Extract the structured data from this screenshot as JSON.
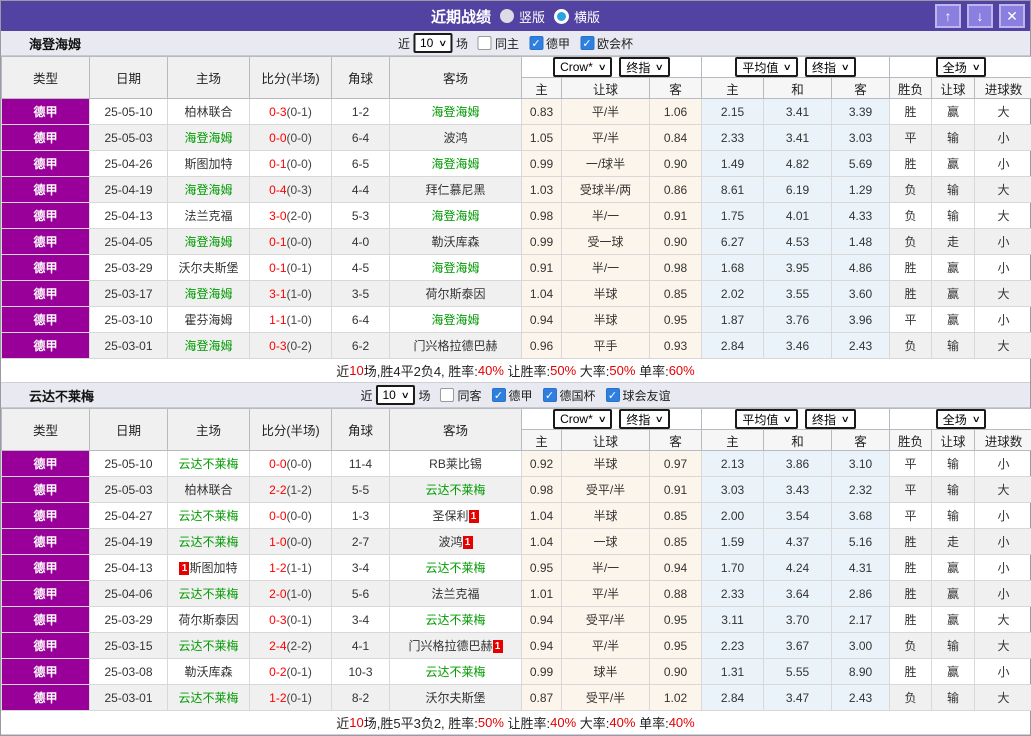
{
  "title_bar": {
    "title": "近期战绩",
    "vertical": {
      "label": "竖版",
      "selected": false
    },
    "horizontal": {
      "label": "横版",
      "selected": true
    },
    "up_icon": "↑",
    "down_icon": "↓",
    "close_icon": "✕"
  },
  "colors": {
    "titlebar_purple": "#5242a1",
    "league_magenta": "#990099",
    "team_green": "#009b00",
    "win_red": "#e60000",
    "draw_green": "#089b08",
    "lose_blue": "#3c3cd8",
    "crow_col_bg": "#fcf5eb",
    "avg_col_bg": "#e9f3f9"
  },
  "columns": {
    "type": "类型",
    "date": "日期",
    "home": "主场",
    "score": "比分(半场)",
    "corner": "角球",
    "away": "客场",
    "group1_select": "Crow*",
    "group1_select2": "终指",
    "g1_home": "主",
    "g1_line": "让球",
    "g1_away": "客",
    "group2_select": "平均值",
    "group2_select2": "终指",
    "g2_home": "主",
    "g2_draw": "和",
    "g2_away": "客",
    "group3_select": "全场",
    "g3_result": "胜负",
    "g3_handicap": "让球",
    "g3_goals": "进球数"
  },
  "sections": [
    {
      "team": "海登海姆",
      "filter": {
        "near": "近",
        "count": "10",
        "games": "场",
        "same": {
          "label": "同主",
          "checked": false
        },
        "leagues": [
          {
            "label": "德甲",
            "checked": true
          },
          {
            "label": "欧会杯",
            "checked": true
          }
        ]
      },
      "rows": [
        {
          "league": "德甲",
          "date": "25-05-10",
          "home": "柏林联合",
          "home_green": false,
          "score_ft": "0-3",
          "score_ht": "(0-1)",
          "corner": "1-2",
          "away": "海登海姆",
          "away_green": true,
          "o1": [
            "0.83",
            "平/半",
            "1.06"
          ],
          "o2": [
            "2.15",
            "3.41",
            "3.39"
          ],
          "res": [
            [
              "胜",
              "r"
            ],
            [
              "赢",
              "r"
            ],
            [
              "大",
              "r"
            ]
          ]
        },
        {
          "league": "德甲",
          "date": "25-05-03",
          "home": "海登海姆",
          "home_green": true,
          "score_ft": "0-0",
          "score_ht": "(0-0)",
          "corner": "6-4",
          "away": "波鸿",
          "away_green": false,
          "o1": [
            "1.05",
            "平/半",
            "0.84"
          ],
          "o2": [
            "2.33",
            "3.41",
            "3.03"
          ],
          "res": [
            [
              "平",
              "g"
            ],
            [
              "输",
              "b"
            ],
            [
              "小",
              "b"
            ]
          ]
        },
        {
          "league": "德甲",
          "date": "25-04-26",
          "home": "斯图加特",
          "home_green": false,
          "score_ft": "0-1",
          "score_ht": "(0-0)",
          "corner": "6-5",
          "away": "海登海姆",
          "away_green": true,
          "o1": [
            "0.99",
            "一/球半",
            "0.90"
          ],
          "o2": [
            "1.49",
            "4.82",
            "5.69"
          ],
          "res": [
            [
              "胜",
              "r"
            ],
            [
              "赢",
              "r"
            ],
            [
              "小",
              "b"
            ]
          ]
        },
        {
          "league": "德甲",
          "date": "25-04-19",
          "home": "海登海姆",
          "home_green": true,
          "score_ft": "0-4",
          "score_ht": "(0-3)",
          "corner": "4-4",
          "away": "拜仁慕尼黑",
          "away_green": false,
          "o1": [
            "1.03",
            "受球半/两",
            "0.86"
          ],
          "o2": [
            "8.61",
            "6.19",
            "1.29"
          ],
          "res": [
            [
              "负",
              "b"
            ],
            [
              "输",
              "b"
            ],
            [
              "大",
              "r"
            ]
          ]
        },
        {
          "league": "德甲",
          "date": "25-04-13",
          "home": "法兰克福",
          "home_green": false,
          "score_ft": "3-0",
          "score_ht": "(2-0)",
          "corner": "5-3",
          "away": "海登海姆",
          "away_green": true,
          "o1": [
            "0.98",
            "半/一",
            "0.91"
          ],
          "o2": [
            "1.75",
            "4.01",
            "4.33"
          ],
          "res": [
            [
              "负",
              "b"
            ],
            [
              "输",
              "b"
            ],
            [
              "大",
              "r"
            ]
          ]
        },
        {
          "league": "德甲",
          "date": "25-04-05",
          "home": "海登海姆",
          "home_green": true,
          "score_ft": "0-1",
          "score_ht": "(0-0)",
          "corner": "4-0",
          "away": "勒沃库森",
          "away_green": false,
          "o1": [
            "0.99",
            "受一球",
            "0.90"
          ],
          "o2": [
            "6.27",
            "4.53",
            "1.48"
          ],
          "res": [
            [
              "负",
              "b"
            ],
            [
              "走",
              "g"
            ],
            [
              "小",
              "b"
            ]
          ]
        },
        {
          "league": "德甲",
          "date": "25-03-29",
          "home": "沃尔夫斯堡",
          "home_green": false,
          "score_ft": "0-1",
          "score_ht": "(0-1)",
          "corner": "4-5",
          "away": "海登海姆",
          "away_green": true,
          "o1": [
            "0.91",
            "半/一",
            "0.98"
          ],
          "o2": [
            "1.68",
            "3.95",
            "4.86"
          ],
          "res": [
            [
              "胜",
              "r"
            ],
            [
              "赢",
              "r"
            ],
            [
              "小",
              "b"
            ]
          ]
        },
        {
          "league": "德甲",
          "date": "25-03-17",
          "home": "海登海姆",
          "home_green": true,
          "score_ft": "3-1",
          "score_ht": "(1-0)",
          "corner": "3-5",
          "away": "荷尔斯泰因",
          "away_green": false,
          "o1": [
            "1.04",
            "半球",
            "0.85"
          ],
          "o2": [
            "2.02",
            "3.55",
            "3.60"
          ],
          "res": [
            [
              "胜",
              "r"
            ],
            [
              "赢",
              "r"
            ],
            [
              "大",
              "r"
            ]
          ]
        },
        {
          "league": "德甲",
          "date": "25-03-10",
          "home": "霍芬海姆",
          "home_green": false,
          "score_ft": "1-1",
          "score_ht": "(1-0)",
          "corner": "6-4",
          "away": "海登海姆",
          "away_green": true,
          "o1": [
            "0.94",
            "半球",
            "0.95"
          ],
          "o2": [
            "1.87",
            "3.76",
            "3.96"
          ],
          "res": [
            [
              "平",
              "g"
            ],
            [
              "赢",
              "r"
            ],
            [
              "小",
              "b"
            ]
          ]
        },
        {
          "league": "德甲",
          "date": "25-03-01",
          "home": "海登海姆",
          "home_green": true,
          "score_ft": "0-3",
          "score_ht": "(0-2)",
          "corner": "6-2",
          "away": "门兴格拉德巴赫",
          "away_green": false,
          "o1": [
            "0.96",
            "平手",
            "0.93"
          ],
          "o2": [
            "2.84",
            "3.46",
            "2.43"
          ],
          "res": [
            [
              "负",
              "b"
            ],
            [
              "输",
              "b"
            ],
            [
              "大",
              "r"
            ]
          ]
        }
      ],
      "summary": [
        {
          "t": "近"
        },
        {
          "t": "10",
          "red": true
        },
        {
          "t": "场,胜4平2负4, 胜率:"
        },
        {
          "t": "40%",
          "red": true
        },
        {
          "t": " 让胜率:"
        },
        {
          "t": "50%",
          "red": true
        },
        {
          "t": " 大率:"
        },
        {
          "t": "50%",
          "red": true
        },
        {
          "t": " 单率:"
        },
        {
          "t": "60%",
          "red": true
        }
      ]
    },
    {
      "team": "云达不莱梅",
      "filter": {
        "near": "近",
        "count": "10",
        "games": "场",
        "same": {
          "label": "同客",
          "checked": false
        },
        "leagues": [
          {
            "label": "德甲",
            "checked": true
          },
          {
            "label": "德国杯",
            "checked": true
          },
          {
            "label": "球会友谊",
            "checked": true
          }
        ]
      },
      "rows": [
        {
          "league": "德甲",
          "date": "25-05-10",
          "home": "云达不莱梅",
          "home_green": true,
          "score_ft": "0-0",
          "score_ht": "(0-0)",
          "corner": "11-4",
          "away": "RB莱比锡",
          "away_green": false,
          "o1": [
            "0.92",
            "半球",
            "0.97"
          ],
          "o2": [
            "2.13",
            "3.86",
            "3.10"
          ],
          "res": [
            [
              "平",
              "g"
            ],
            [
              "输",
              "b"
            ],
            [
              "小",
              "b"
            ]
          ]
        },
        {
          "league": "德甲",
          "date": "25-05-03",
          "home": "柏林联合",
          "home_green": false,
          "score_ft": "2-2",
          "score_ht": "(1-2)",
          "corner": "5-5",
          "away": "云达不莱梅",
          "away_green": true,
          "o1": [
            "0.98",
            "受平/半",
            "0.91"
          ],
          "o2": [
            "3.03",
            "3.43",
            "2.32"
          ],
          "res": [
            [
              "平",
              "g"
            ],
            [
              "输",
              "b"
            ],
            [
              "大",
              "r"
            ]
          ]
        },
        {
          "league": "德甲",
          "date": "25-04-27",
          "home": "云达不莱梅",
          "home_green": true,
          "score_ft": "0-0",
          "score_ht": "(0-0)",
          "corner": "1-3",
          "away": "圣保利",
          "away_green": false,
          "away_badge": "1",
          "o1": [
            "1.04",
            "半球",
            "0.85"
          ],
          "o2": [
            "2.00",
            "3.54",
            "3.68"
          ],
          "res": [
            [
              "平",
              "g"
            ],
            [
              "输",
              "b"
            ],
            [
              "小",
              "b"
            ]
          ]
        },
        {
          "league": "德甲",
          "date": "25-04-19",
          "home": "云达不莱梅",
          "home_green": true,
          "score_ft": "1-0",
          "score_ht": "(0-0)",
          "corner": "2-7",
          "away": "波鸿",
          "away_green": false,
          "away_badge": "1",
          "o1": [
            "1.04",
            "一球",
            "0.85"
          ],
          "o2": [
            "1.59",
            "4.37",
            "5.16"
          ],
          "res": [
            [
              "胜",
              "r"
            ],
            [
              "走",
              "g"
            ],
            [
              "小",
              "b"
            ]
          ]
        },
        {
          "league": "德甲",
          "date": "25-04-13",
          "home": "斯图加特",
          "home_green": false,
          "home_badge": "1",
          "score_ft": "1-2",
          "score_ht": "(1-1)",
          "corner": "3-4",
          "away": "云达不莱梅",
          "away_green": true,
          "o1": [
            "0.95",
            "半/一",
            "0.94"
          ],
          "o2": [
            "1.70",
            "4.24",
            "4.31"
          ],
          "res": [
            [
              "胜",
              "r"
            ],
            [
              "赢",
              "r"
            ],
            [
              "小",
              "b"
            ]
          ]
        },
        {
          "league": "德甲",
          "date": "25-04-06",
          "home": "云达不莱梅",
          "home_green": true,
          "score_ft": "2-0",
          "score_ht": "(1-0)",
          "corner": "5-6",
          "away": "法兰克福",
          "away_green": false,
          "o1": [
            "1.01",
            "平/半",
            "0.88"
          ],
          "o2": [
            "2.33",
            "3.64",
            "2.86"
          ],
          "res": [
            [
              "胜",
              "r"
            ],
            [
              "赢",
              "r"
            ],
            [
              "小",
              "b"
            ]
          ]
        },
        {
          "league": "德甲",
          "date": "25-03-29",
          "home": "荷尔斯泰因",
          "home_green": false,
          "score_ft": "0-3",
          "score_ht": "(0-1)",
          "corner": "3-4",
          "away": "云达不莱梅",
          "away_green": true,
          "o1": [
            "0.94",
            "受平/半",
            "0.95"
          ],
          "o2": [
            "3.11",
            "3.70",
            "2.17"
          ],
          "res": [
            [
              "胜",
              "r"
            ],
            [
              "赢",
              "r"
            ],
            [
              "大",
              "r"
            ]
          ]
        },
        {
          "league": "德甲",
          "date": "25-03-15",
          "home": "云达不莱梅",
          "home_green": true,
          "score_ft": "2-4",
          "score_ht": "(2-2)",
          "corner": "4-1",
          "away": "门兴格拉德巴赫",
          "away_green": false,
          "away_badge": "1",
          "o1": [
            "0.94",
            "平/半",
            "0.95"
          ],
          "o2": [
            "2.23",
            "3.67",
            "3.00"
          ],
          "res": [
            [
              "负",
              "b"
            ],
            [
              "输",
              "b"
            ],
            [
              "大",
              "r"
            ]
          ]
        },
        {
          "league": "德甲",
          "date": "25-03-08",
          "home": "勒沃库森",
          "home_green": false,
          "score_ft": "0-2",
          "score_ht": "(0-1)",
          "corner": "10-3",
          "away": "云达不莱梅",
          "away_green": true,
          "o1": [
            "0.99",
            "球半",
            "0.90"
          ],
          "o2": [
            "1.31",
            "5.55",
            "8.90"
          ],
          "res": [
            [
              "胜",
              "r"
            ],
            [
              "赢",
              "r"
            ],
            [
              "小",
              "b"
            ]
          ]
        },
        {
          "league": "德甲",
          "date": "25-03-01",
          "home": "云达不莱梅",
          "home_green": true,
          "score_ft": "1-2",
          "score_ht": "(0-1)",
          "corner": "8-2",
          "away": "沃尔夫斯堡",
          "away_green": false,
          "o1": [
            "0.87",
            "受平/半",
            "1.02"
          ],
          "o2": [
            "2.84",
            "3.47",
            "2.43"
          ],
          "res": [
            [
              "负",
              "b"
            ],
            [
              "输",
              "b"
            ],
            [
              "大",
              "r"
            ]
          ]
        }
      ],
      "summary": [
        {
          "t": "近"
        },
        {
          "t": "10",
          "red": true
        },
        {
          "t": "场,胜5平3负2, 胜率:"
        },
        {
          "t": "50%",
          "red": true
        },
        {
          "t": " 让胜率:"
        },
        {
          "t": "40%",
          "red": true
        },
        {
          "t": " 大率:"
        },
        {
          "t": "40%",
          "red": true
        },
        {
          "t": " 单率:"
        },
        {
          "t": "40%",
          "red": true
        }
      ]
    }
  ]
}
